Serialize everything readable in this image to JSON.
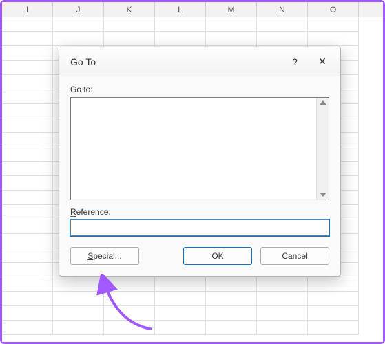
{
  "spreadsheet": {
    "columns": [
      "I",
      "J",
      "K",
      "L",
      "M",
      "N",
      "O"
    ]
  },
  "dialog": {
    "title": "Go To",
    "help_label": "?",
    "close_label": "✕",
    "goto_label": "Go to:",
    "reference_label_prefix": "R",
    "reference_label_rest": "eference:",
    "reference_value": "",
    "buttons": {
      "special_prefix": "S",
      "special_rest": "pecial...",
      "ok": "OK",
      "cancel": "Cancel"
    }
  },
  "annotation": {
    "color": "#a259ff"
  }
}
